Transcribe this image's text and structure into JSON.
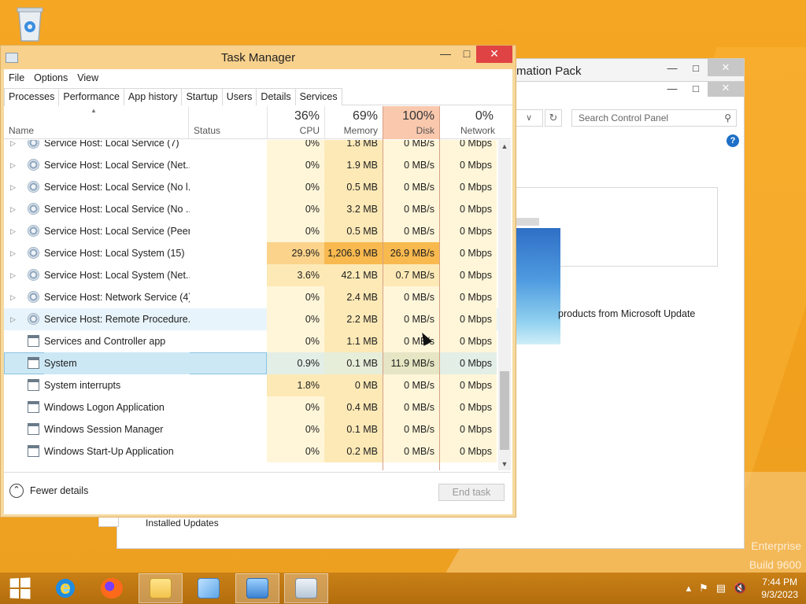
{
  "taskmgr": {
    "title": "Task Manager",
    "menu": [
      "File",
      "Options",
      "View"
    ],
    "tabs": [
      "Processes",
      "Performance",
      "App history",
      "Startup",
      "Users",
      "Details",
      "Services"
    ],
    "columns": {
      "name": "Name",
      "status": "Status",
      "cpu": {
        "label": "CPU",
        "pct": "36%"
      },
      "memory": {
        "label": "Memory",
        "pct": "69%"
      },
      "disk": {
        "label": "Disk",
        "pct": "100%"
      },
      "network": {
        "label": "Network",
        "pct": "0%"
      }
    },
    "rows": [
      {
        "name": "Service Host: Local Service (7)",
        "cpu": "0%",
        "mem": "1.8 MB",
        "disk": "0 MB/s",
        "net": "0 Mbps"
      },
      {
        "name": "Service Host: Local Service (Net...",
        "cpu": "0%",
        "mem": "1.9 MB",
        "disk": "0 MB/s",
        "net": "0 Mbps"
      },
      {
        "name": "Service Host: Local Service (No l...",
        "cpu": "0%",
        "mem": "0.5 MB",
        "disk": "0 MB/s",
        "net": "0 Mbps"
      },
      {
        "name": "Service Host: Local Service (No ...",
        "cpu": "0%",
        "mem": "3.2 MB",
        "disk": "0 MB/s",
        "net": "0 Mbps"
      },
      {
        "name": "Service Host: Local Service (Peer...",
        "cpu": "0%",
        "mem": "0.5 MB",
        "disk": "0 MB/s",
        "net": "0 Mbps"
      },
      {
        "name": "Service Host: Local System (15)",
        "cpu": "29.9%",
        "mem": "1,206.9 MB",
        "disk": "26.9 MB/s",
        "net": "0 Mbps"
      },
      {
        "name": "Service Host: Local System (Net...",
        "cpu": "3.6%",
        "mem": "42.1 MB",
        "disk": "0.7 MB/s",
        "net": "0 Mbps"
      },
      {
        "name": "Service Host: Network Service (4)",
        "cpu": "0%",
        "mem": "2.4 MB",
        "disk": "0 MB/s",
        "net": "0 Mbps"
      },
      {
        "name": "Service Host: Remote Procedure...",
        "cpu": "0%",
        "mem": "2.2 MB",
        "disk": "0 MB/s",
        "net": "0 Mbps"
      },
      {
        "name": "Services and Controller app",
        "cpu": "0%",
        "mem": "1.1 MB",
        "disk": "0 MB/s",
        "net": "0 Mbps"
      },
      {
        "name": "System",
        "cpu": "0.9%",
        "mem": "0.1 MB",
        "disk": "11.9 MB/s",
        "net": "0 Mbps"
      },
      {
        "name": "System interrupts",
        "cpu": "1.8%",
        "mem": "0 MB",
        "disk": "0 MB/s",
        "net": "0 Mbps"
      },
      {
        "name": "Windows Logon Application",
        "cpu": "0%",
        "mem": "0.4 MB",
        "disk": "0 MB/s",
        "net": "0 Mbps"
      },
      {
        "name": "Windows Session Manager",
        "cpu": "0%",
        "mem": "0.1 MB",
        "disk": "0 MB/s",
        "net": "0 Mbps"
      },
      {
        "name": "Windows Start-Up Application",
        "cpu": "0%",
        "mem": "0.2 MB",
        "disk": "0 MB/s",
        "net": "0 Mbps"
      }
    ],
    "fewer_details": "Fewer details",
    "end_task": "End task"
  },
  "control_panel": {
    "title": "mation Pack",
    "search_placeholder": "Search Control Panel",
    "help": "?",
    "update_text": "products from Microsoft Update",
    "installed_updates": "Installed Updates"
  },
  "desktop": {
    "watermark_1": "Enterprise",
    "watermark_2": "Build 9600"
  },
  "taskbar": {
    "time": "7:44 PM",
    "date": "9/3/2023"
  }
}
